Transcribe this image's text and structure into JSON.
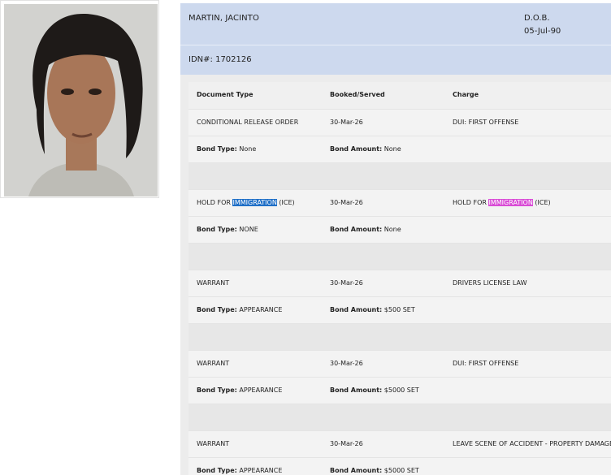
{
  "inmate": {
    "name": "MARTIN, JACINTO",
    "dob_label": "D.O.B.",
    "dob": "05-Jul-90",
    "idn_label": "IDN#:",
    "idn": "1702126"
  },
  "table": {
    "headers": [
      "Document Type",
      "Booked/Served",
      "Charge"
    ],
    "bond_type_label": "Bond Type:",
    "bond_amount_label": "Bond Amount:",
    "entries": [
      {
        "doc_type": "CONDITIONAL RELEASE ORDER",
        "booked": "30-Mar-26",
        "charge": "DUI: FIRST OFFENSE",
        "bond_type": "None",
        "bond_amount": "None"
      },
      {
        "doc_type_prefix": "HOLD FOR",
        "doc_type_highlight": "IMMIGRATION",
        "doc_type_suffix": "(ICE)",
        "booked": "30-Mar-26",
        "charge_prefix": "HOLD FOR",
        "charge_highlight": "IMMIGRATION",
        "charge_suffix": "(ICE)",
        "bond_type": "NONE",
        "bond_amount": "None"
      },
      {
        "doc_type": "WARRANT",
        "booked": "30-Mar-26",
        "charge": "DRIVERS LICENSE LAW",
        "bond_type": "APPEARANCE",
        "bond_amount": "$500 SET"
      },
      {
        "doc_type": "WARRANT",
        "booked": "30-Mar-26",
        "charge": "DUI: FIRST OFFENSE",
        "bond_type": "APPEARANCE",
        "bond_amount": "$5000 SET"
      },
      {
        "doc_type": "WARRANT",
        "booked": "30-Mar-26",
        "charge": "LEAVE SCENE OF ACCIDENT - PROPERTY DAMAGE",
        "bond_type": "APPEARANCE",
        "bond_amount": "$5000 SET"
      }
    ]
  },
  "colors": {
    "header_bg": "#cdd9ee",
    "highlight_blue": "#1f6fc7",
    "highlight_pink": "#d94cd6"
  }
}
